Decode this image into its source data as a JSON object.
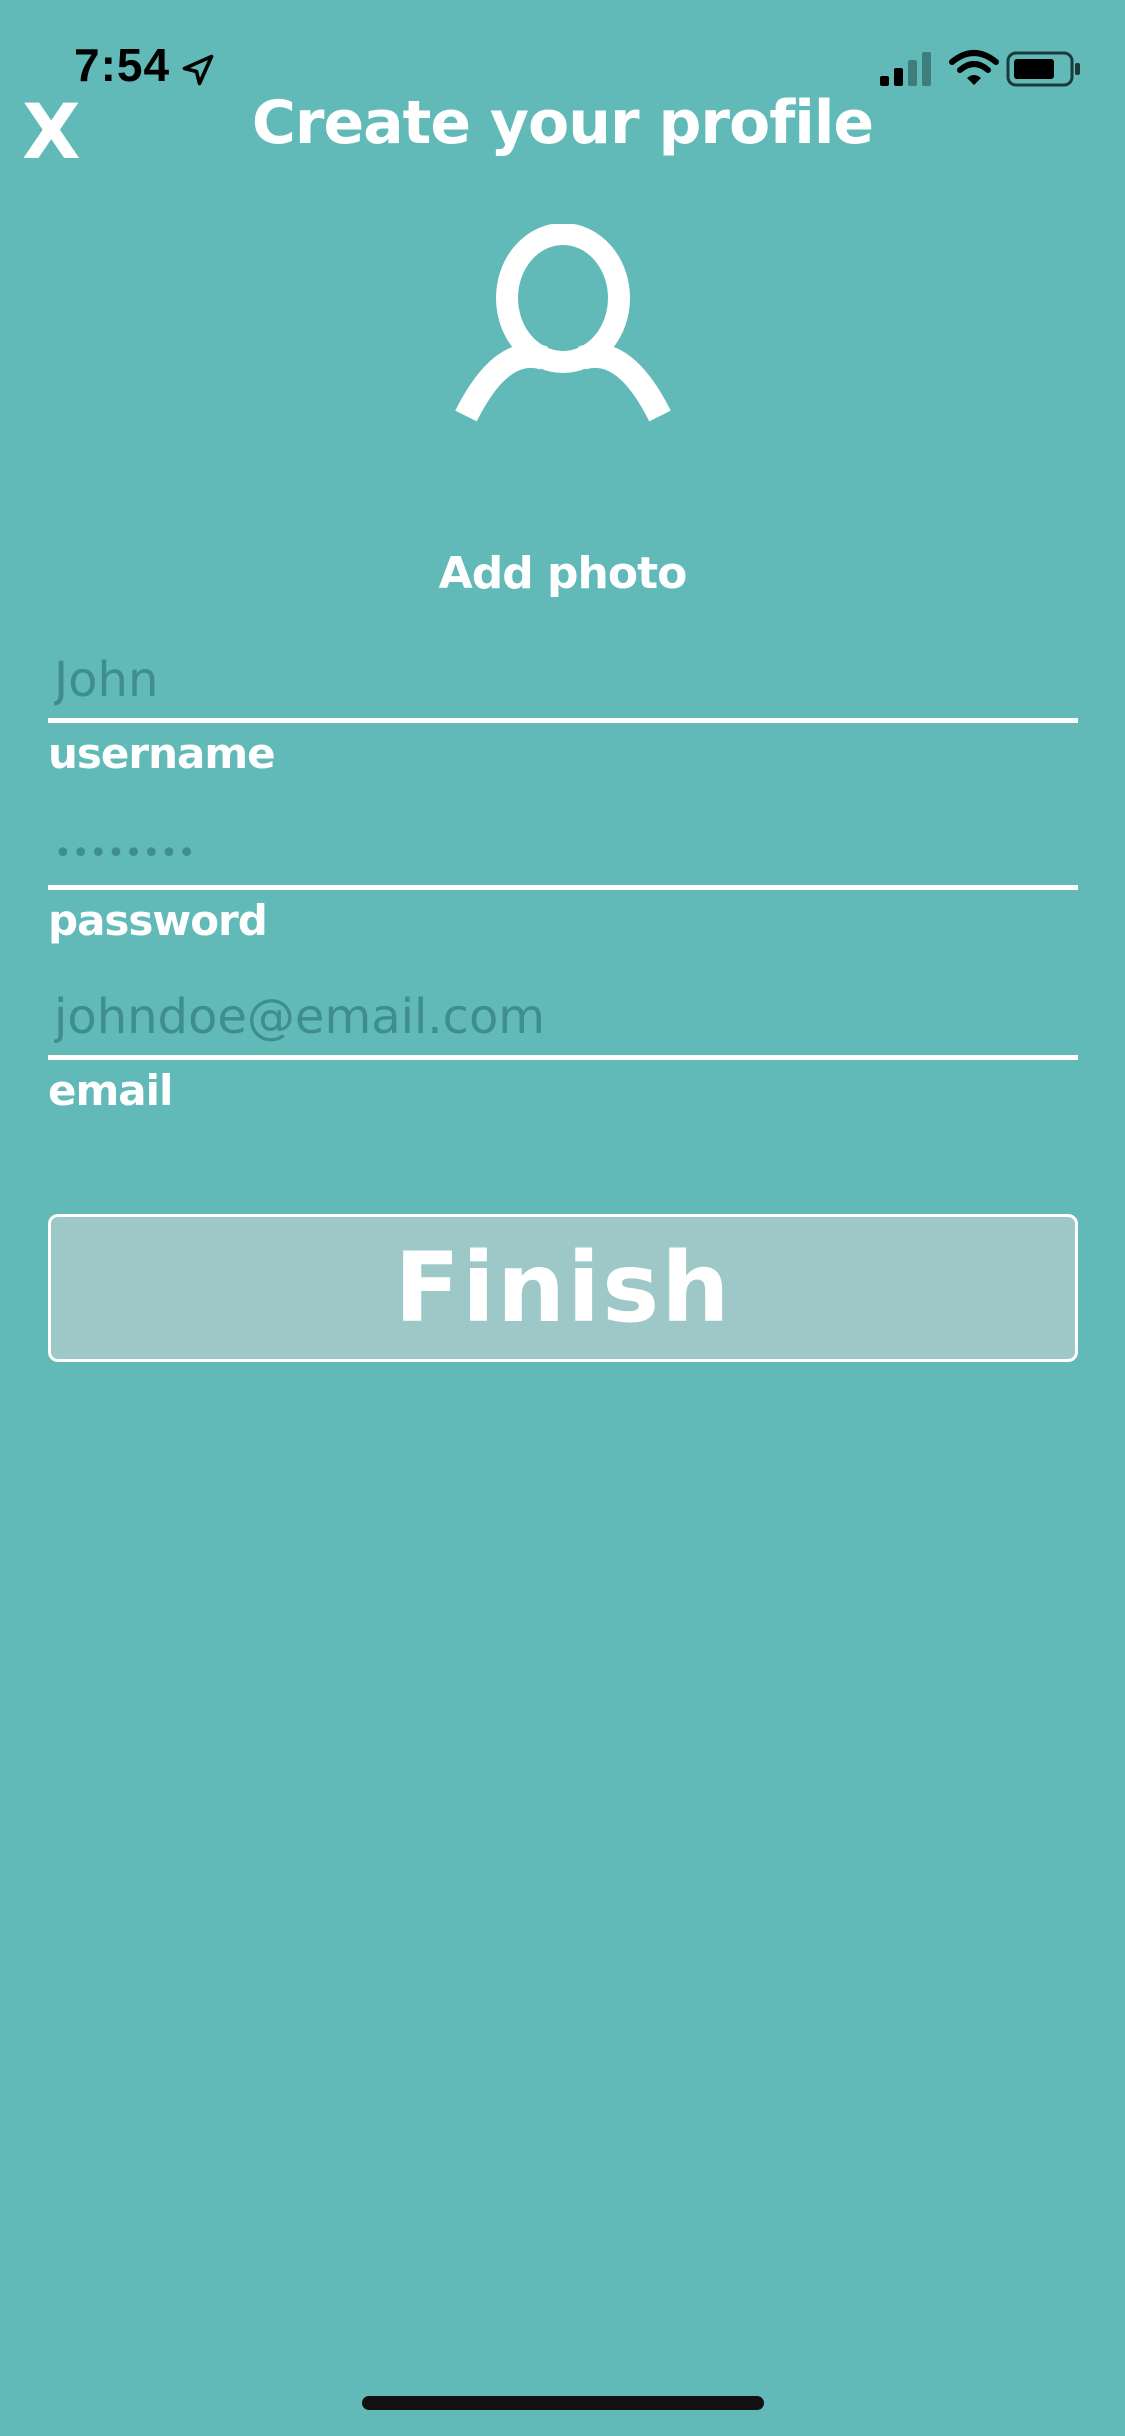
{
  "status_bar": {
    "time": "7:54",
    "icons": [
      "location-arrow-icon",
      "cellular-signal-icon",
      "wifi-icon",
      "battery-icon"
    ]
  },
  "header": {
    "close_label": "X",
    "title": "Create your profile"
  },
  "avatar": {
    "icon": "user-silhouette-icon",
    "add_photo_label": "Add photo"
  },
  "form": {
    "username": {
      "placeholder": "John",
      "value": "",
      "label": "username"
    },
    "password": {
      "placeholder": "••••••••",
      "value": "",
      "label": "password"
    },
    "email": {
      "placeholder": "johndoe@email.com",
      "value": "",
      "label": "email"
    }
  },
  "finish_button": {
    "label": "Finish"
  },
  "colors": {
    "background": "#61BAB8",
    "placeholder": "#3F8E8C",
    "button_fill": "#9EC8C8",
    "foreground": "#FFFFFF"
  }
}
